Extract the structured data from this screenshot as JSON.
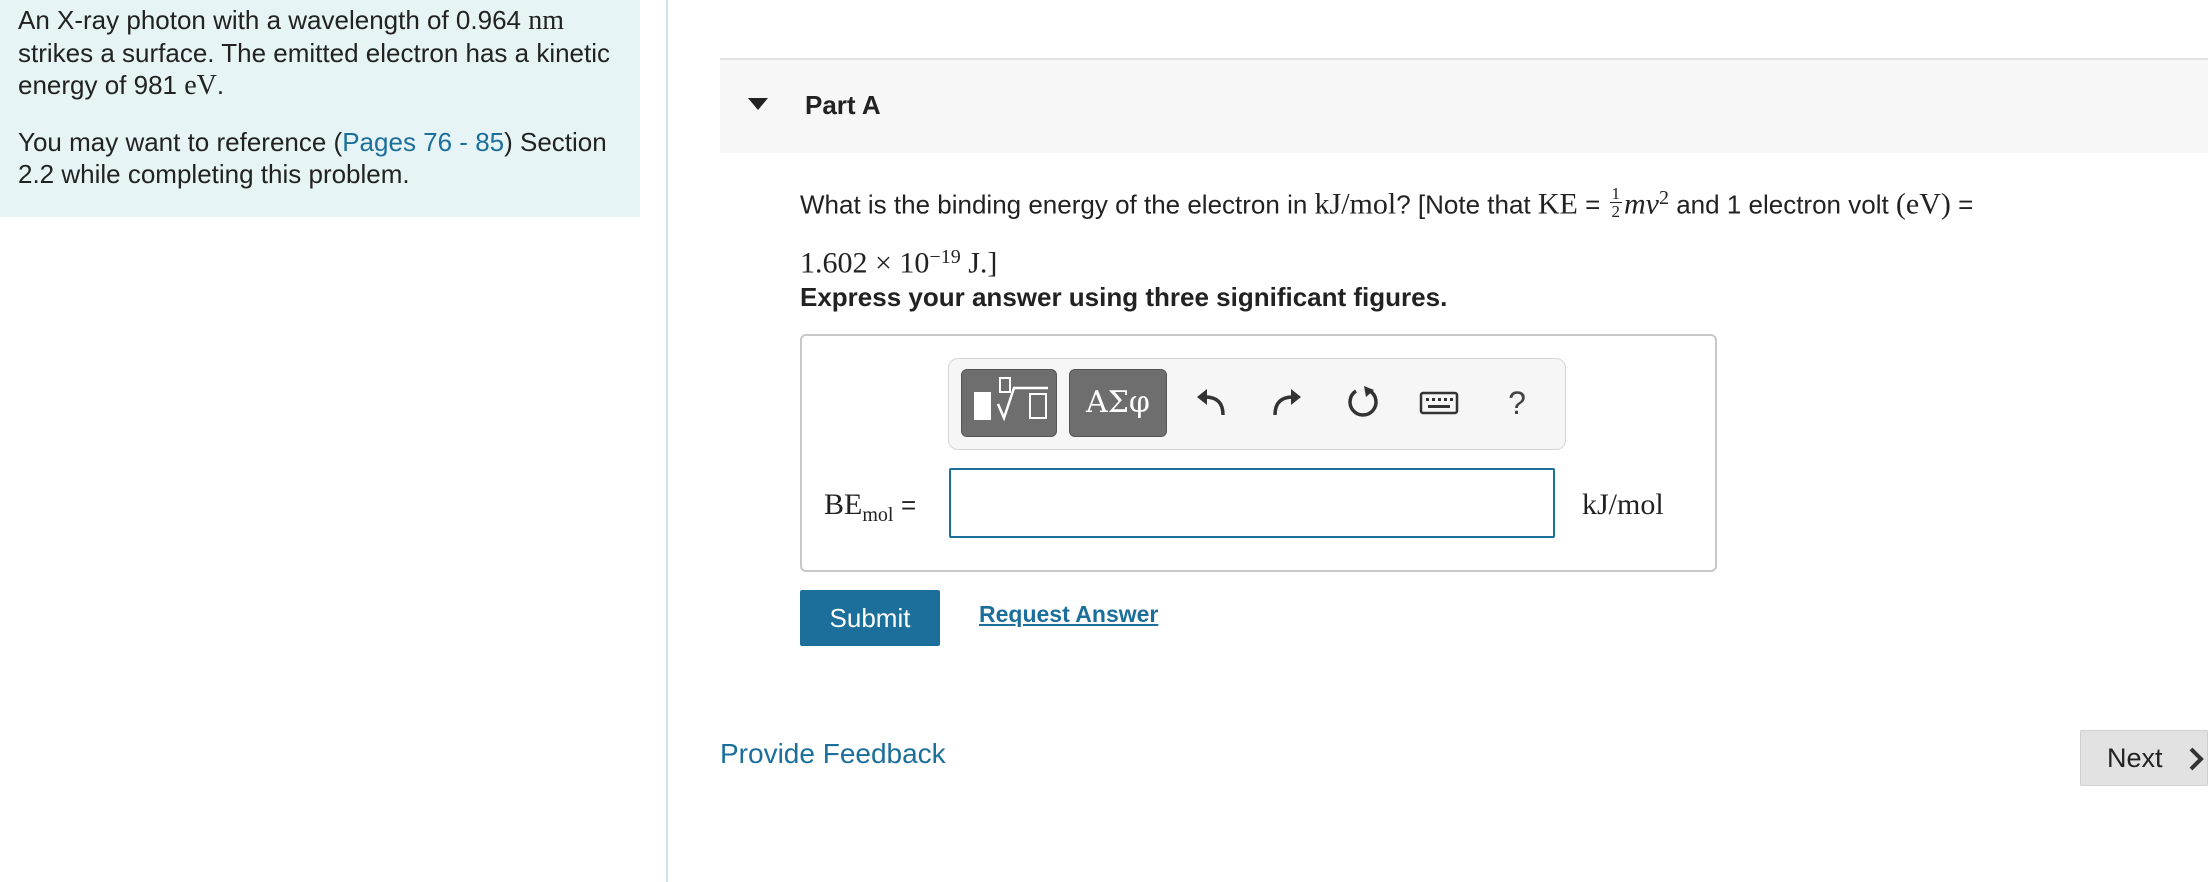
{
  "problem": {
    "sentence_start": "An X-ray photon with a wavelength of 0.964 ",
    "wavelength_unit": "nm",
    "sentence_mid": " strikes a surface. The emitted electron has a kinetic energy of 981 ",
    "energy_unit": "eV",
    "sentence_end": ".",
    "reference_prefix": "You may want to reference (",
    "reference_link": "Pages 76 - 85",
    "reference_suffix": ") Section 2.2 while completing this problem."
  },
  "part": {
    "title": "Part A"
  },
  "question": {
    "text1": "What is the binding energy of the electron in ",
    "unit": "kJ/mol",
    "text2": "? [Note that ",
    "ke": "KE",
    "eq": " = ",
    "frac_num": "1",
    "frac_den": "2",
    "mv": "mv",
    "mv_exp": "2",
    "text3": " and 1 electron volt ",
    "ev": "(eV)",
    "text4": " =",
    "value": "1.602 × 10",
    "value_exp": "−19",
    "value_unit": " J.]"
  },
  "instruction": "Express your answer using three significant figures.",
  "answer": {
    "label_main": "BE",
    "label_sub": "mol",
    "equals": "=",
    "value": "",
    "unit": "kJ/mol"
  },
  "toolbar": {
    "symbols_label": "ΑΣφ",
    "help_label": "?",
    "icons": [
      "templates-icon",
      "undo-icon",
      "redo-icon",
      "reset-icon",
      "keyboard-icon",
      "help-icon"
    ]
  },
  "actions": {
    "submit_label": "Submit",
    "request_answer_label": "Request Answer",
    "feedback_label": "Provide Feedback",
    "next_label": "Next"
  },
  "colors": {
    "accent": "#1c6f9a",
    "panel_bg": "#e6f4f5"
  }
}
